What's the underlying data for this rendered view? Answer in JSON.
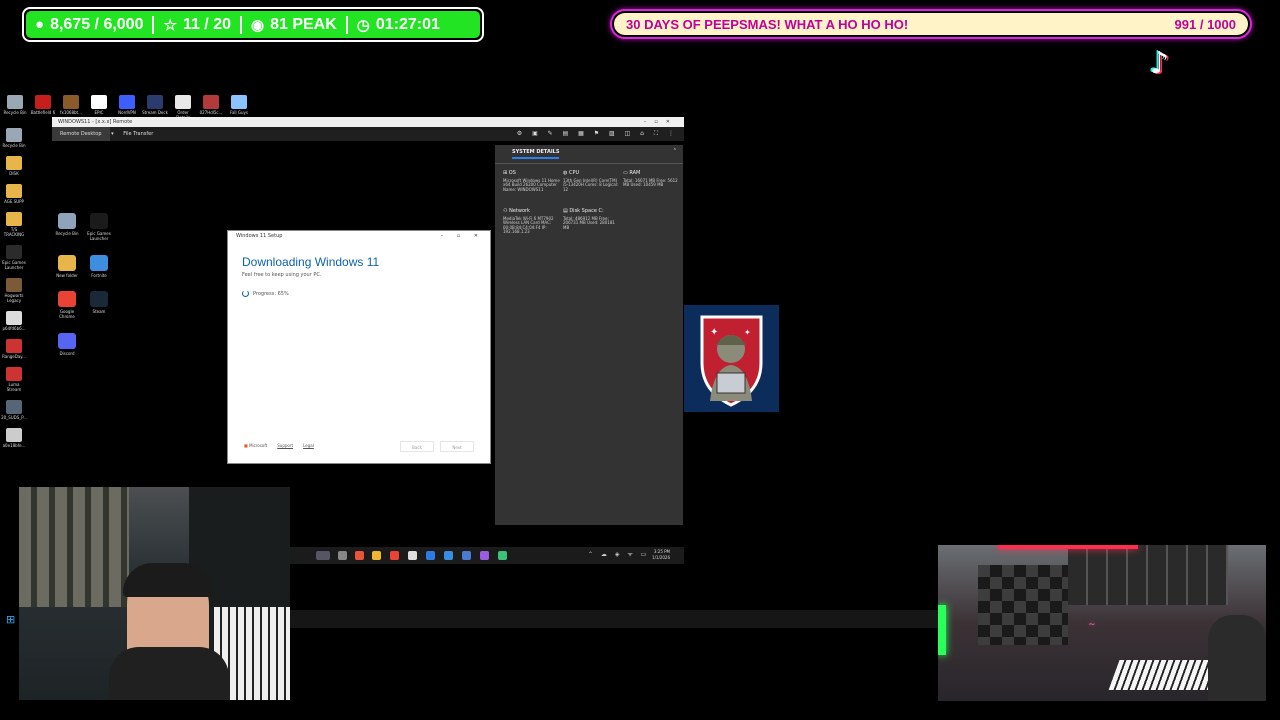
{
  "stats_bar": {
    "followers": "8,675 / 6,000",
    "rating": "11 / 20",
    "peak": "81 PEAK",
    "timer": "01:27:01"
  },
  "goal_bar": {
    "title": "30 DAYS OF PEEPSMAS! WHAT A HO HO HO!",
    "progress": "991 / 1000",
    "progress_value": 0.991
  },
  "desktop_icons_top": [
    {
      "label": "Recycle Bin",
      "color": "#9aa7b5"
    },
    {
      "label": "Battlefield 6",
      "color": "#c61d1d"
    },
    {
      "label": "fx1068bt...",
      "color": "#8a5a2a"
    },
    {
      "label": "EPIC",
      "color": "#ffffff"
    },
    {
      "label": "NordVPN",
      "color": "#3e5fff"
    },
    {
      "label": "Stream Deck",
      "color": "#2c3b6d"
    },
    {
      "label": "Order Details",
      "color": "#e8e8e8"
    },
    {
      "label": "027Hdl5c...",
      "color": "#b23a3a"
    },
    {
      "label": "Fall Guys",
      "color": "#8cc3ff"
    }
  ],
  "desktop_icons_left": [
    {
      "label": "Recycle Bin"
    },
    {
      "label": "DISK"
    },
    {
      "label": "AGE SUPP"
    },
    {
      "label": "T/S TRACKING"
    },
    {
      "label": "Epic Games Launcher"
    },
    {
      "label": "Hogwarts Legacy"
    },
    {
      "label": "p64fd6b6..."
    },
    {
      "label": "RangeDay..."
    },
    {
      "label": "Luma Stream"
    },
    {
      "label": "20_SUDS_P..."
    },
    {
      "label": "a0e18bfe..."
    }
  ],
  "remote_window": {
    "title": "WINDOWS11 - [x.x.x] Remote",
    "tabs": [
      "Remote Desktop",
      "File Transfer"
    ]
  },
  "system_details": {
    "header": "SYSTEM DETAILS",
    "os_title": "OS",
    "os_body": "Microsoft Windows 11 Home x64 Build 26200 Computer Name: WINDOWS11",
    "cpu_title": "CPU",
    "cpu_body": "13th Gen Intel(R) Core(TM) i5-13420H Cores: 8 Logical: 12",
    "ram_title": "RAM",
    "ram_body": "Total: 16071 MB Free: 5612 MB Used: 10459 MB",
    "network_title": "Network",
    "network_body": "MediaTek Wi-Fi 6 MT7902 Wireless LAN Card MAC: 00:0B:84:C4:04:F4 IP: 192.168.1.23",
    "disk_title": "Disk Space C:",
    "disk_body": "Total: 486912 MB Free: 206731 MB Used: 280181 MB"
  },
  "inner_desktop_icons": [
    {
      "label": "Recycle Bin",
      "color": "#8fa4bb"
    },
    {
      "label": "Epic Games Launcher",
      "color": "#1b1b1b"
    },
    {
      "label": "New folder",
      "color": "#e8b54a"
    },
    {
      "label": "Fortnite",
      "color": "#3d8ee0"
    },
    {
      "label": "Google Chrome",
      "color": "#e94335"
    },
    {
      "label": "Steam",
      "color": "#1b2838"
    },
    {
      "label": "Discord",
      "color": "#5865f2"
    }
  ],
  "setup_dialog": {
    "title": "Windows 11 Setup",
    "heading": "Downloading Windows 11",
    "subtitle": "Feel free to keep using your PC.",
    "progress_label": "Progress: 65%",
    "progress_value": 0.65,
    "brand": "Microsoft",
    "support_link": "Support",
    "legal_link": "Legal",
    "back_label": "Back",
    "next_label": "Next"
  },
  "taskbar": {
    "time": "3:25 PM",
    "date": "1/1/2026"
  },
  "colors": {
    "stats_green": "#23e423",
    "goal_magenta": "#d52ad8",
    "goal_fill": "#fff3c7",
    "windows_blue": "#0d62b0"
  }
}
